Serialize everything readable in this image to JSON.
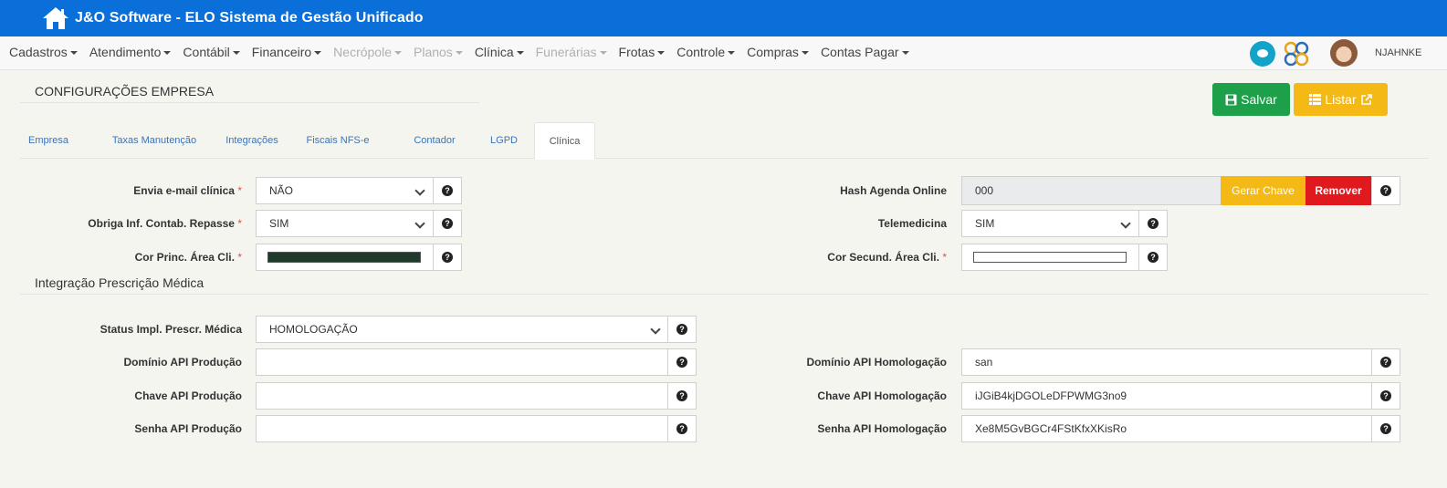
{
  "app": {
    "title": "J&O Software - ELO Sistema de Gestão Unificado",
    "home_icon": "home-icon"
  },
  "menu": {
    "items": [
      {
        "label": "Cadastros",
        "disabled": false
      },
      {
        "label": "Atendimento",
        "disabled": false
      },
      {
        "label": "Contábil",
        "disabled": false
      },
      {
        "label": "Financeiro",
        "disabled": false
      },
      {
        "label": "Necrópole",
        "disabled": true
      },
      {
        "label": "Planos",
        "disabled": true
      },
      {
        "label": "Clínica",
        "disabled": false
      },
      {
        "label": "Funerárias",
        "disabled": true
      },
      {
        "label": "Frotas",
        "disabled": false
      },
      {
        "label": "Controle",
        "disabled": false
      },
      {
        "label": "Compras",
        "disabled": false
      },
      {
        "label": "Contas Pagar",
        "disabled": false
      }
    ],
    "username": "NJAHNKE"
  },
  "page": {
    "title": "CONFIGURAÇÕES EMPRESA"
  },
  "actions": {
    "save_label": "Salvar",
    "list_label": "Listar"
  },
  "tabs": [
    "Empresa",
    "Taxas Manutenção",
    "Integrações",
    "Fiscais NFS-e",
    "Contador",
    "LGPD",
    "Clínica"
  ],
  "active_tab": "Clínica",
  "clinica": {
    "envia_email": {
      "label": "Envia e-mail clínica",
      "value": "NÃO"
    },
    "obriga_inf": {
      "label": "Obriga Inf. Contab. Repasse",
      "value": "SIM"
    },
    "cor_princ": {
      "label": "Cor Princ. Área Cli.",
      "color": "#1f3a2a"
    },
    "hash_agenda": {
      "label": "Hash Agenda Online",
      "value": "000",
      "generate_label": "Gerar Chave",
      "remove_label": "Remover"
    },
    "telemedicina": {
      "label": "Telemedicina",
      "value": "SIM"
    },
    "cor_secund": {
      "label": "Cor Secund. Área Cli.",
      "color": "#ffffff"
    },
    "required_mark": "*"
  },
  "prescricao": {
    "title": "Integração Prescrição Médica",
    "status": {
      "label": "Status Impl. Prescr. Médica",
      "value": "HOMOLOGAÇÃO"
    },
    "dominio_prod": {
      "label": "Domínio API Produção",
      "value": ""
    },
    "chave_prod": {
      "label": "Chave API Produção",
      "value": ""
    },
    "senha_prod": {
      "label": "Senha API Produção",
      "value": ""
    },
    "dominio_homol": {
      "label": "Domínio API Homologação",
      "value": "san"
    },
    "chave_homol": {
      "label": "Chave API Homologação",
      "value": "iJGiB4kjDGOLeDFPWMG3no9"
    },
    "senha_homol": {
      "label": "Senha API Homologação",
      "value": "Xe8M5GvBGCr4FStKfxXKisRo"
    }
  },
  "help_icon_glyph": "?"
}
